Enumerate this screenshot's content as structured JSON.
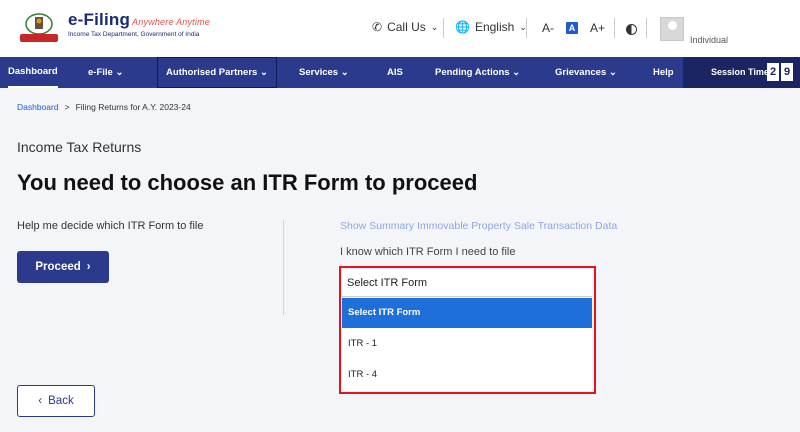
{
  "header": {
    "logo_title": "e-Filing",
    "logo_tagline": "Anywhere Anytime",
    "logo_subtitle": "Income Tax Department, Government of India",
    "call_us": "Call Us",
    "language": "English",
    "font_decrease": "A-",
    "font_normal": "A",
    "font_increase": "A+",
    "user_type": "Individual"
  },
  "nav": {
    "items": [
      "Dashboard",
      "e-File",
      "Authorised Partners",
      "Services",
      "AIS",
      "Pending Actions",
      "Grievances",
      "Help"
    ],
    "session_label": "Session Time",
    "session_digits": [
      "2",
      "9"
    ]
  },
  "breadcrumb": {
    "home": "Dashboard",
    "separator": ">",
    "current": "Filing Returns for A.Y. 2023-24"
  },
  "main": {
    "section_title": "Income Tax Returns",
    "page_title": "You need to choose an ITR Form to proceed",
    "help_text": "Help me decide which ITR Form to file",
    "proceed_label": "Proceed",
    "summary_link": "Show Summary Immovable Property Sale Transaction Data",
    "know_text": "I know which ITR Form I need to file",
    "select_value": "Select ITR Form",
    "options": [
      "Select ITR Form",
      "ITR - 1",
      "ITR - 4"
    ],
    "back_label": "Back"
  },
  "colors": {
    "nav_bg": "#2b3a8c",
    "session_bg": "#1b2563",
    "accent_blue": "#1e6fd9",
    "highlight_red": "#e3141e"
  }
}
